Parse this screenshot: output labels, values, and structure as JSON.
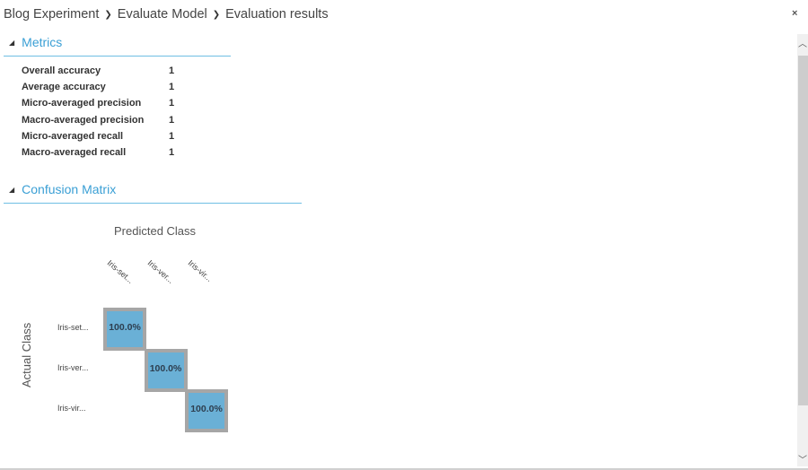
{
  "breadcrumb": {
    "items": [
      "Blog Experiment",
      "Evaluate Model",
      "Evaluation results"
    ],
    "separator": "❯"
  },
  "close_icon": "×",
  "metrics": {
    "title": "Metrics",
    "collapse_icon": "◢",
    "rows": [
      {
        "label": "Overall accuracy",
        "value": "1"
      },
      {
        "label": "Average accuracy",
        "value": "1"
      },
      {
        "label": "Micro-averaged precision",
        "value": "1"
      },
      {
        "label": "Macro-averaged precision",
        "value": "1"
      },
      {
        "label": "Micro-averaged recall",
        "value": "1"
      },
      {
        "label": "Macro-averaged recall",
        "value": "1"
      }
    ]
  },
  "confusion_matrix": {
    "title": "Confusion Matrix",
    "collapse_icon": "◢",
    "predicted_label": "Predicted Class",
    "actual_label": "Actual Class",
    "classes": [
      "Iris-set...",
      "Iris-ver...",
      "Iris-vir..."
    ],
    "cells": [
      {
        "row": 0,
        "col": 0,
        "value": "100.0%"
      },
      {
        "row": 1,
        "col": 1,
        "value": "100.0%"
      },
      {
        "row": 2,
        "col": 2,
        "value": "100.0%"
      }
    ],
    "cell_color": "#6ab0d6",
    "border_color": "#a6a6a6"
  },
  "scrollbar": {
    "up_icon": "︿",
    "down_icon": "﹀"
  }
}
